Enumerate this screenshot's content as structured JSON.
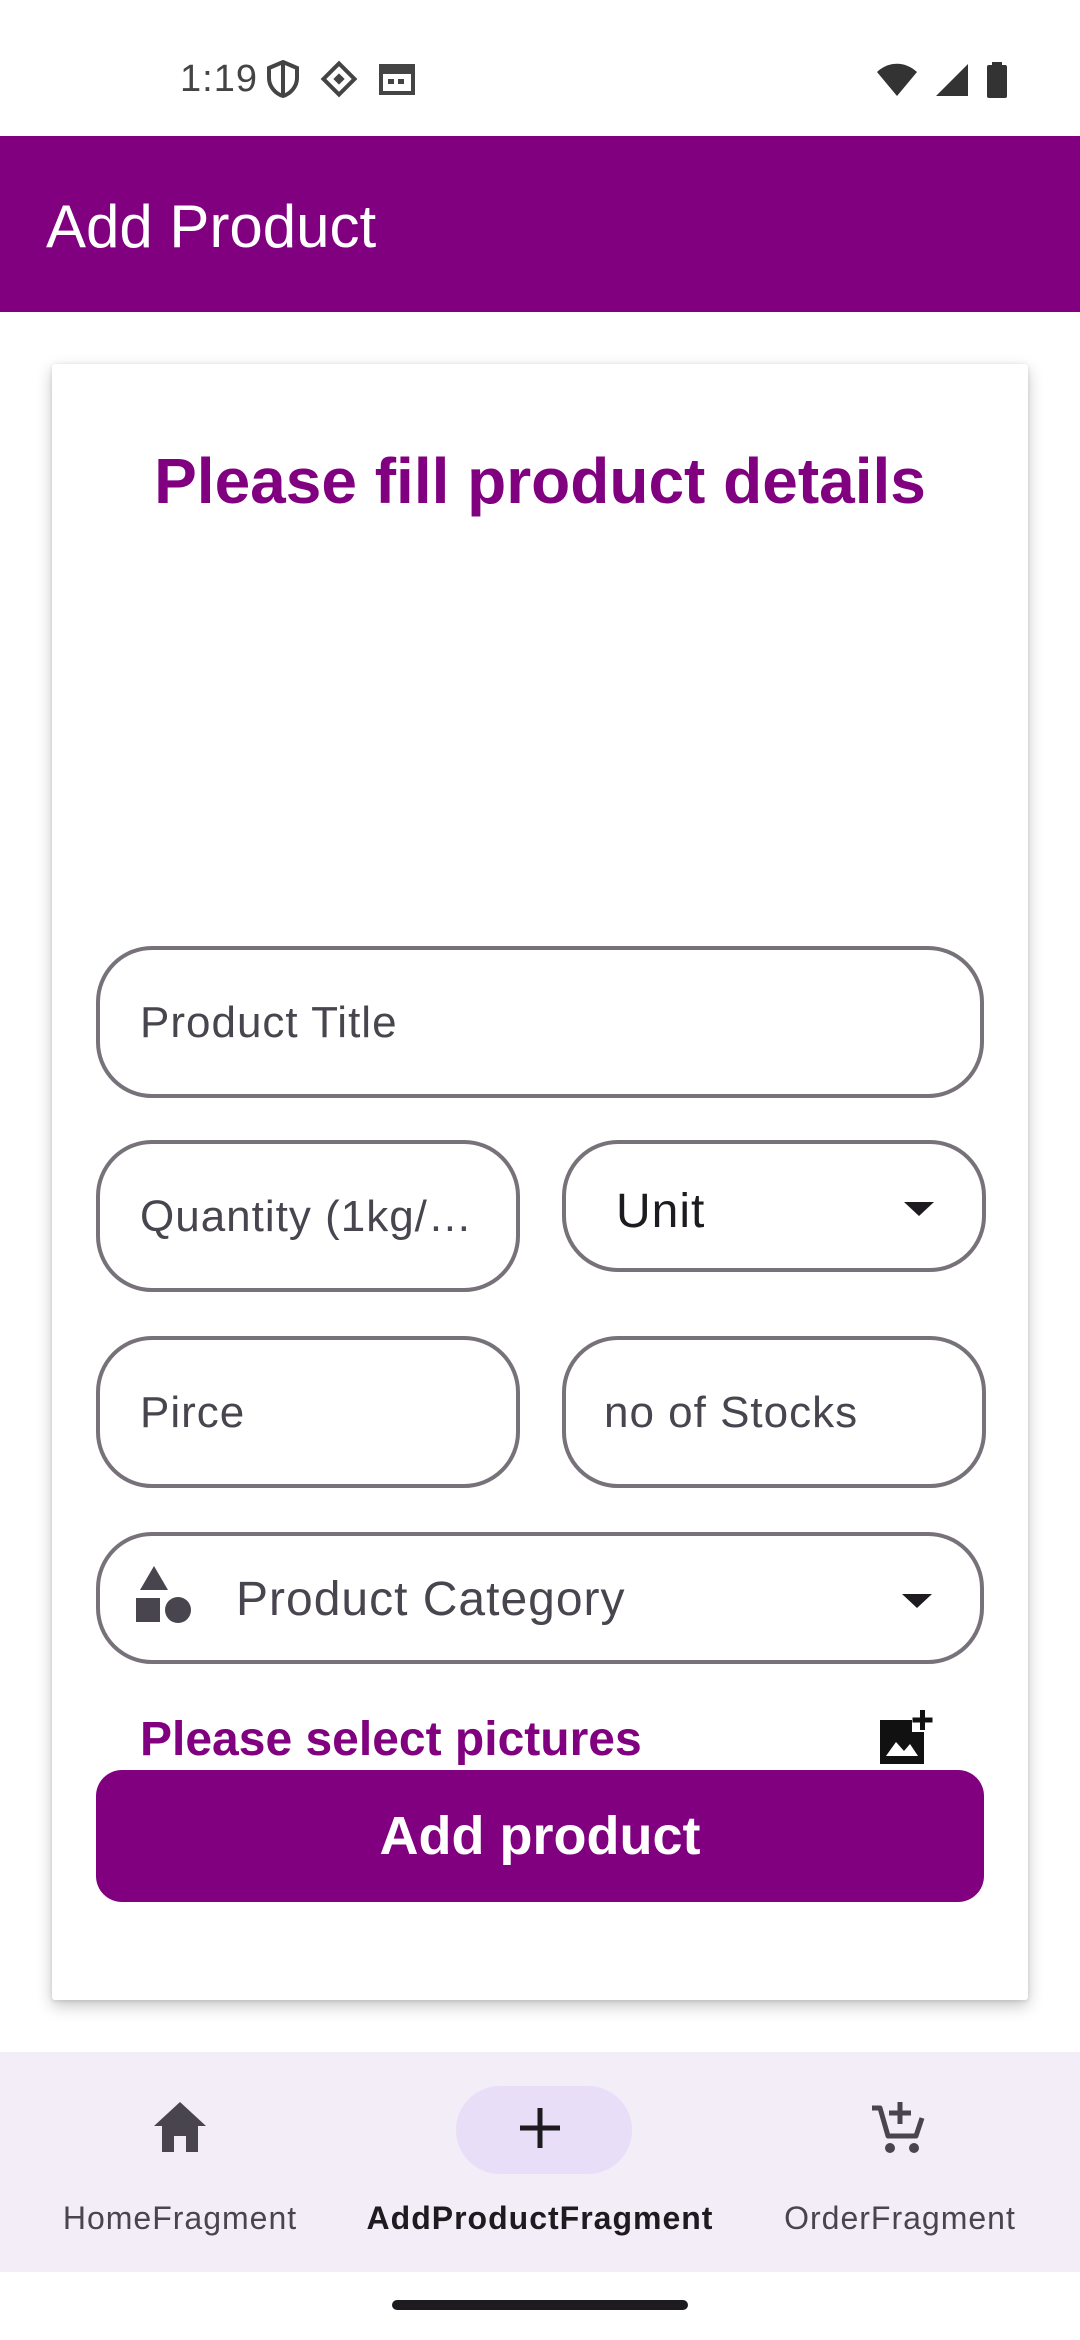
{
  "status_bar": {
    "time": "1:19"
  },
  "app_bar": {
    "title": "Add Product"
  },
  "form": {
    "heading": "Please fill product details",
    "product_title_placeholder": "Product Title",
    "quantity_placeholder": "Quantity (1kg/…",
    "unit_label": "Unit",
    "price_placeholder": "Pirce",
    "stocks_placeholder": "no of Stocks",
    "category_label": "Product Category",
    "pictures_label": "Please select pictures",
    "submit_label": "Add product"
  },
  "bottom_nav": {
    "items": [
      {
        "label": "HomeFragment",
        "icon": "home-icon",
        "active": false
      },
      {
        "label": "AddProductFragment",
        "icon": "plus-icon",
        "active": true
      },
      {
        "label": "OrderFragment",
        "icon": "add-to-cart-icon",
        "active": false
      }
    ]
  },
  "colors": {
    "brand": "#800080",
    "field_outline": "#77717a",
    "nav_background": "#f2edf7",
    "nav_indicator": "#e8def8"
  }
}
